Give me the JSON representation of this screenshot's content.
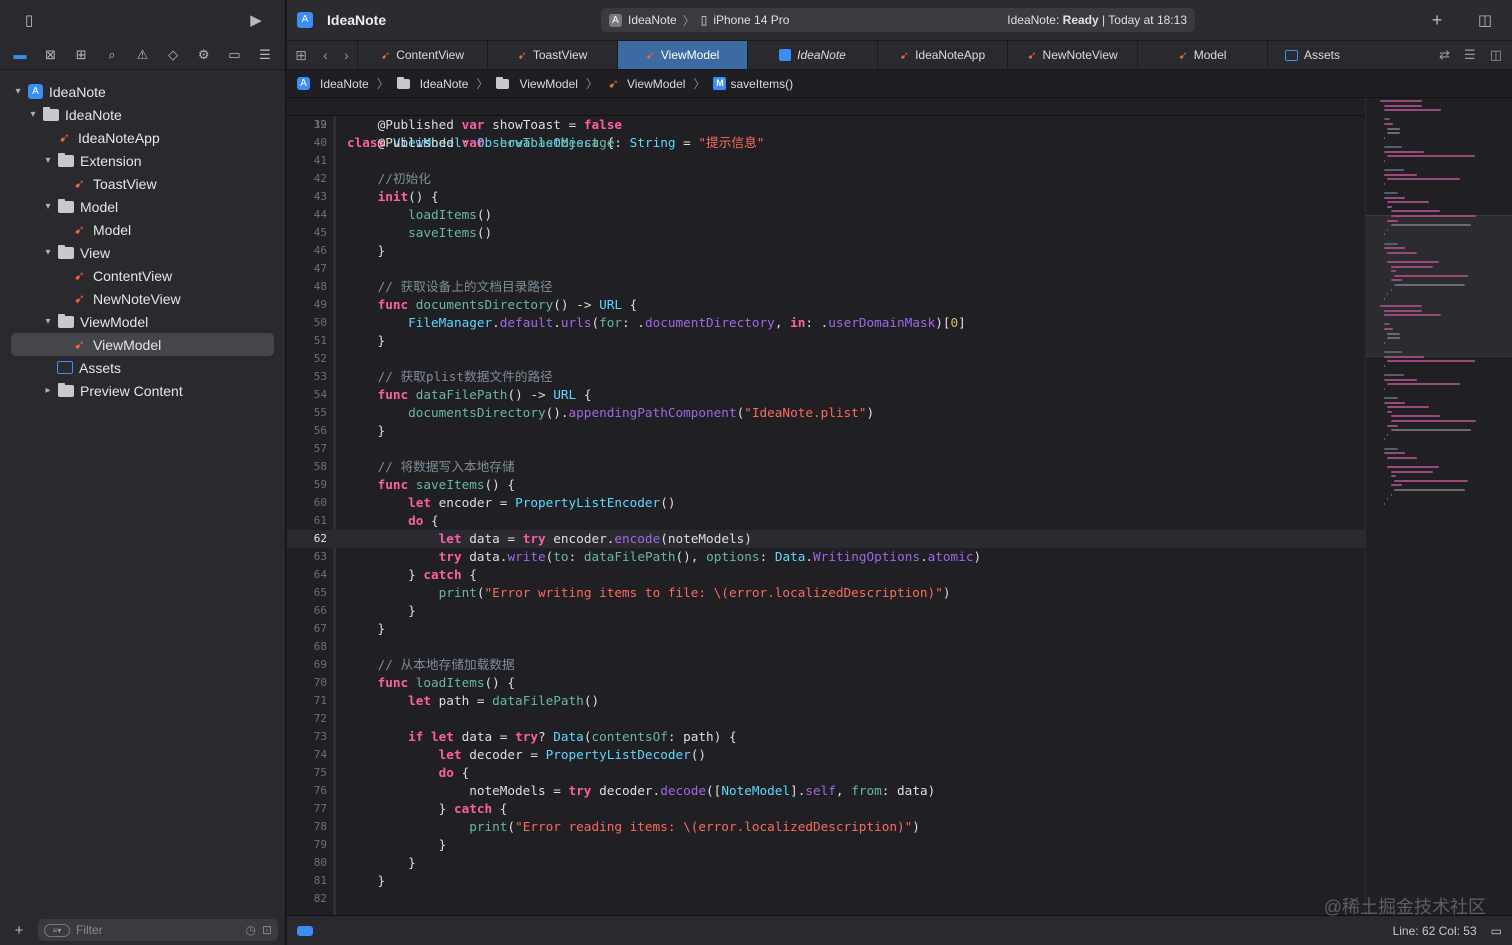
{
  "project_name": "IdeaNote",
  "scheme": {
    "target": "IdeaNote",
    "device": "iPhone 14 Pro",
    "status_prefix": "IdeaNote: ",
    "status_state": "Ready",
    "status_time": "| Today at 18:13"
  },
  "tree": [
    {
      "label": "IdeaNote",
      "kind": "project"
    },
    {
      "label": "IdeaNote",
      "kind": "folder"
    },
    {
      "label": "IdeaNoteApp",
      "kind": "swift"
    },
    {
      "label": "Extension",
      "kind": "folder"
    },
    {
      "label": "ToastView",
      "kind": "swift"
    },
    {
      "label": "Model",
      "kind": "folder"
    },
    {
      "label": "Model",
      "kind": "swift"
    },
    {
      "label": "View",
      "kind": "folder"
    },
    {
      "label": "ContentView",
      "kind": "swift"
    },
    {
      "label": "NewNoteView",
      "kind": "swift"
    },
    {
      "label": "ViewModel",
      "kind": "folder"
    },
    {
      "label": "ViewModel",
      "kind": "swift"
    },
    {
      "label": "Assets",
      "kind": "assets"
    },
    {
      "label": "Preview Content",
      "kind": "folder"
    }
  ],
  "filter_placeholder": "Filter",
  "tabs": [
    "ContentView",
    "ToastView",
    "ViewModel",
    "IdeaNote",
    "IdeaNoteApp",
    "NewNoteView",
    "Model",
    "Assets"
  ],
  "active_tab": "ViewModel",
  "breadcrumb": [
    "IdeaNote",
    "IdeaNote",
    "ViewModel",
    "ViewModel",
    "saveItems()"
  ],
  "header_line": {
    "number": "12",
    "text": "class ViewModel: ObservableObject {"
  },
  "code_lines": [
    {
      "n": "39",
      "t": "    @Published var showToast = false"
    },
    {
      "n": "40",
      "t": "    @Published var showToastMessage: String = \"提示信息\""
    },
    {
      "n": "41",
      "t": ""
    },
    {
      "n": "42",
      "t": "    //初始化"
    },
    {
      "n": "43",
      "t": "    init() {"
    },
    {
      "n": "44",
      "t": "        loadItems()"
    },
    {
      "n": "45",
      "t": "        saveItems()"
    },
    {
      "n": "46",
      "t": "    }"
    },
    {
      "n": "47",
      "t": ""
    },
    {
      "n": "48",
      "t": "    // 获取设备上的文档目录路径"
    },
    {
      "n": "49",
      "t": "    func documentsDirectory() -> URL {"
    },
    {
      "n": "50",
      "t": "        FileManager.default.urls(for: .documentDirectory, in: .userDomainMask)[0]"
    },
    {
      "n": "51",
      "t": "    }"
    },
    {
      "n": "52",
      "t": ""
    },
    {
      "n": "53",
      "t": "    // 获取plist数据文件的路径"
    },
    {
      "n": "54",
      "t": "    func dataFilePath() -> URL {"
    },
    {
      "n": "55",
      "t": "        documentsDirectory().appendingPathComponent(\"IdeaNote.plist\")"
    },
    {
      "n": "56",
      "t": "    }"
    },
    {
      "n": "57",
      "t": ""
    },
    {
      "n": "58",
      "t": "    // 将数据写入本地存储"
    },
    {
      "n": "59",
      "t": "    func saveItems() {"
    },
    {
      "n": "60",
      "t": "        let encoder = PropertyListEncoder()"
    },
    {
      "n": "61",
      "t": "        do {"
    },
    {
      "n": "62",
      "t": "            let data = try encoder.encode(noteModels)"
    },
    {
      "n": "63",
      "t": "            try data.write(to: dataFilePath(), options: Data.WritingOptions.atomic)"
    },
    {
      "n": "64",
      "t": "        } catch {"
    },
    {
      "n": "65",
      "t": "            print(\"Error writing items to file: \\(error.localizedDescription)\")"
    },
    {
      "n": "66",
      "t": "        }"
    },
    {
      "n": "67",
      "t": "    }"
    },
    {
      "n": "68",
      "t": ""
    },
    {
      "n": "69",
      "t": "    // 从本地存储加载数据"
    },
    {
      "n": "70",
      "t": "    func loadItems() {"
    },
    {
      "n": "71",
      "t": "        let path = dataFilePath()"
    },
    {
      "n": "72",
      "t": ""
    },
    {
      "n": "73",
      "t": "        if let data = try? Data(contentsOf: path) {"
    },
    {
      "n": "74",
      "t": "            let decoder = PropertyListDecoder()"
    },
    {
      "n": "75",
      "t": "            do {"
    },
    {
      "n": "76",
      "t": "                noteModels = try decoder.decode([NoteModel].self, from: data)"
    },
    {
      "n": "77",
      "t": "            } catch {"
    },
    {
      "n": "78",
      "t": "                print(\"Error reading items: \\(error.localizedDescription)\")"
    },
    {
      "n": "79",
      "t": "            }"
    },
    {
      "n": "80",
      "t": "        }"
    },
    {
      "n": "81",
      "t": "    }"
    },
    {
      "n": "82",
      "t": ""
    }
  ],
  "current_line": "62",
  "status": {
    "line_col": "Line: 62  Col: 53"
  },
  "watermark": "@稀土掘金技术社区",
  "colors": {
    "accent": "#3a8ef6",
    "keyword": "#fc5fa3",
    "type": "#5dd8ff",
    "string": "#fc6a5d",
    "comment": "#7f8c98",
    "swift_icon": "#f06a35"
  }
}
